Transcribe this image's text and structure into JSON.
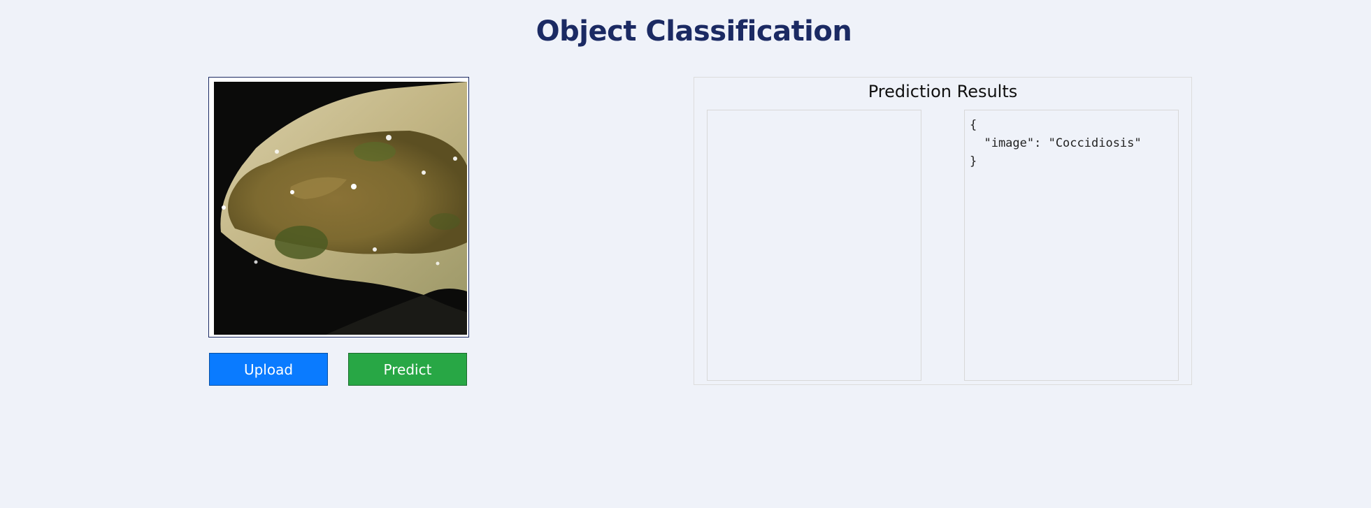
{
  "header": {
    "title": "Object Classification"
  },
  "controls": {
    "upload_label": "Upload",
    "predict_label": "Predict"
  },
  "results": {
    "title": "Prediction Results",
    "json_text": "{\n  \"image\": \"Coccidiosis\"\n}"
  },
  "colors": {
    "title": "#1b2a63",
    "upload_button": "#0a7bff",
    "predict_button": "#28a745",
    "background": "#eff2f9"
  }
}
